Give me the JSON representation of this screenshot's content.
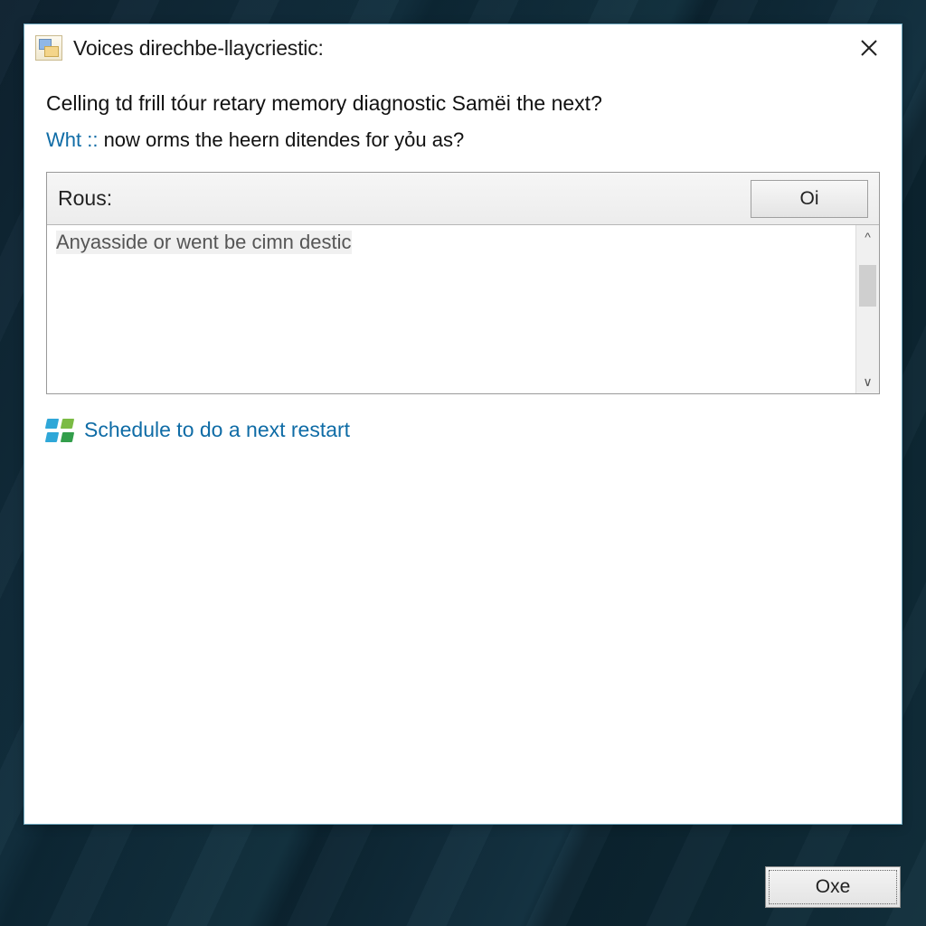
{
  "dialog": {
    "title": "Voices direchbe-llaycriestic:",
    "heading": "Celling td frill tóur retary memory diagnostic Samëi the next?",
    "subline_accent": "Wht ::",
    "subline_rest": " now orms the heern ditendes for yỏu as?"
  },
  "panel": {
    "label": "Rous:",
    "oi_button": "Oi",
    "content_row": "Anyasside or went be cimn destic"
  },
  "schedule_link": "Schedule to do a next restart",
  "footer_button": "Oxe"
}
